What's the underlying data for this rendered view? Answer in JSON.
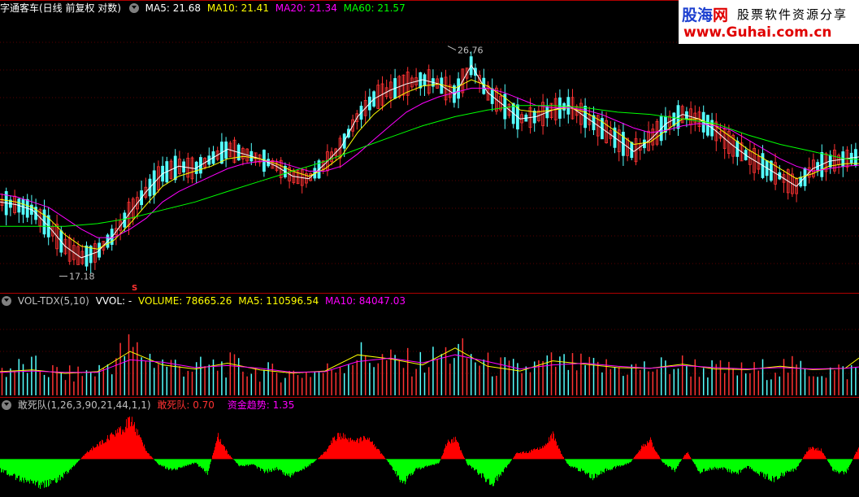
{
  "main": {
    "title": "字通客车(日线 前复权 对数)",
    "ma5_label": "MA5: 21.68",
    "ma10_label": "MA10: 21.41",
    "ma20_label": "MA20: 21.34",
    "ma60_label": "MA60: 21.57",
    "high_label": "26.76",
    "low_label": "17.18",
    "signal_label": "S"
  },
  "vol": {
    "title": "VOL-TDX(5,10)",
    "vvol_label": "VVOL: -",
    "volume_label": "VOLUME: 78665.26",
    "ma5_label": "MA5: 110596.54",
    "ma10_label": "MA10: 84047.03"
  },
  "ind": {
    "title": "敢死队(1,26,3,90,21,44,1,1)",
    "gsd_label": "敢死队: 0.70",
    "zjqs_label": "资金趋势: 1.35"
  },
  "watermark": {
    "line1_blue": "股海",
    "line1_red": "网",
    "line1_right": "股票软件资源分享",
    "line2": "www.Guhai.com.cn"
  },
  "colors": {
    "up": "#ff3232",
    "down": "#54ffff",
    "ma5": "#ffffff",
    "ma10": "#ffff00",
    "ma20": "#ff00ff",
    "ma60": "#00ff00",
    "separator": "#b00000",
    "positive_fill": "#ff0000",
    "negative_fill": "#00ff00"
  },
  "chart_data": [
    {
      "type": "candlestick",
      "title": "字通客车(日线 前复权 对数)",
      "series": [
        {
          "name": "MA5",
          "x": [
            0,
            20,
            40,
            60,
            80,
            100,
            120,
            140,
            160,
            180,
            200,
            220,
            240,
            260,
            280,
            300,
            320,
            340,
            360,
            380,
            400,
            420,
            440,
            460,
            480,
            500,
            520,
            540,
            560,
            580,
            600,
            620,
            640,
            660,
            680,
            700,
            720,
            740,
            760,
            780,
            800,
            820,
            840,
            860,
            880,
            900,
            920,
            940,
            960,
            980,
            1000,
            1020,
            1040,
            1057
          ],
          "values": [
            19.9,
            19.8,
            19.6,
            19.0,
            18.3,
            17.9,
            18.1,
            18.7,
            19.5,
            20.3,
            21.0,
            21.3,
            21.2,
            21.6,
            22.0,
            21.8,
            21.6,
            21.3,
            20.9,
            20.8,
            21.4,
            22.1,
            23.4,
            24.2,
            24.6,
            24.9,
            25.1,
            24.9,
            24.4,
            25.8,
            24.5,
            23.9,
            23.3,
            23.4,
            23.7,
            23.9,
            23.4,
            22.9,
            22.4,
            21.9,
            22.4,
            23.1,
            23.5,
            23.3,
            22.8,
            22.2,
            21.7,
            21.3,
            20.9,
            20.5,
            21.2,
            21.5,
            21.6,
            21.68
          ]
        },
        {
          "name": "MA10",
          "x": [
            0,
            20,
            40,
            60,
            80,
            100,
            120,
            140,
            160,
            180,
            200,
            220,
            240,
            260,
            280,
            300,
            320,
            340,
            360,
            380,
            400,
            420,
            440,
            460,
            480,
            500,
            520,
            540,
            560,
            580,
            600,
            620,
            640,
            660,
            680,
            700,
            720,
            740,
            760,
            780,
            800,
            820,
            840,
            860,
            880,
            900,
            920,
            940,
            960,
            980,
            1000,
            1020,
            1040,
            1057
          ],
          "values": [
            20.0,
            19.9,
            19.7,
            19.3,
            18.7,
            18.3,
            18.2,
            18.5,
            19.1,
            19.8,
            20.5,
            20.9,
            21.1,
            21.3,
            21.6,
            21.7,
            21.6,
            21.4,
            21.1,
            20.9,
            21.2,
            21.7,
            22.7,
            23.5,
            24.1,
            24.5,
            24.8,
            24.9,
            24.7,
            25.1,
            24.8,
            24.3,
            23.7,
            23.6,
            23.7,
            23.8,
            23.6,
            23.2,
            22.7,
            22.2,
            22.3,
            22.8,
            23.3,
            23.3,
            23.0,
            22.5,
            22.0,
            21.6,
            21.2,
            20.8,
            21.0,
            21.3,
            21.4,
            21.41
          ]
        },
        {
          "name": "MA20",
          "x": [
            0,
            20,
            40,
            60,
            80,
            100,
            120,
            140,
            160,
            180,
            200,
            220,
            240,
            260,
            280,
            300,
            320,
            340,
            360,
            380,
            400,
            420,
            440,
            460,
            480,
            500,
            520,
            540,
            560,
            580,
            600,
            620,
            640,
            660,
            680,
            700,
            720,
            740,
            760,
            780,
            800,
            820,
            840,
            860,
            880,
            900,
            920,
            940,
            960,
            980,
            1000,
            1020,
            1040,
            1057
          ],
          "values": [
            20.2,
            20.1,
            19.9,
            19.7,
            19.3,
            18.9,
            18.6,
            18.6,
            18.9,
            19.3,
            19.9,
            20.3,
            20.6,
            20.9,
            21.2,
            21.4,
            21.5,
            21.5,
            21.3,
            21.1,
            21.1,
            21.3,
            21.8,
            22.4,
            23.0,
            23.6,
            24.0,
            24.3,
            24.5,
            24.7,
            24.7,
            24.5,
            24.2,
            23.9,
            23.8,
            23.8,
            23.7,
            23.5,
            23.2,
            22.9,
            22.7,
            22.8,
            23.0,
            23.1,
            23.0,
            22.8,
            22.4,
            22.0,
            21.6,
            21.3,
            21.1,
            21.2,
            21.3,
            21.34
          ]
        },
        {
          "name": "MA60",
          "x": [
            0,
            40,
            80,
            120,
            160,
            200,
            240,
            280,
            320,
            360,
            400,
            440,
            480,
            520,
            560,
            600,
            640,
            680,
            720,
            760,
            800,
            840,
            880,
            920,
            960,
            1000,
            1040,
            1057
          ],
          "values": [
            19.0,
            19.0,
            19.0,
            19.1,
            19.3,
            19.6,
            19.9,
            20.3,
            20.7,
            21.1,
            21.5,
            22.0,
            22.5,
            23.0,
            23.4,
            23.7,
            23.9,
            23.9,
            23.8,
            23.6,
            23.5,
            23.3,
            23.1,
            22.6,
            22.2,
            21.9,
            21.6,
            21.57
          ]
        }
      ],
      "annotations": [
        {
          "text": "26.76"
        },
        {
          "text": "17.18"
        }
      ],
      "ylim": [
        16.8,
        28.4
      ],
      "scale": "log"
    },
    {
      "type": "bar",
      "title": "VOL-TDX(5,10)",
      "series": [
        {
          "name": "VOLUME",
          "x": [
            0,
            40,
            80,
            120,
            160,
            200,
            240,
            280,
            320,
            360,
            400,
            440,
            480,
            520,
            560,
            600,
            640,
            680,
            720,
            760,
            800,
            840,
            880,
            920,
            960,
            1000,
            1040,
            1057
          ],
          "values": [
            75000,
            85000,
            60000,
            70000,
            140000,
            95000,
            80000,
            90000,
            70000,
            65000,
            70000,
            120000,
            100000,
            95000,
            130000,
            90000,
            75000,
            95000,
            85000,
            80000,
            80000,
            90000,
            75000,
            70000,
            85000,
            75000,
            70000,
            78665
          ]
        },
        {
          "name": "MA5",
          "x": [
            0,
            40,
            80,
            120,
            160,
            200,
            240,
            280,
            320,
            360,
            400,
            440,
            480,
            520,
            560,
            600,
            640,
            680,
            720,
            760,
            800,
            840,
            880,
            920,
            960,
            1000,
            1040,
            1057
          ],
          "values": [
            70000,
            75000,
            65000,
            70000,
            130000,
            90000,
            78000,
            95000,
            75000,
            66000,
            72000,
            120000,
            108000,
            90000,
            140000,
            86000,
            72000,
            102000,
            92000,
            82000,
            80000,
            92000,
            78000,
            76000,
            86000,
            76000,
            80000,
            110597
          ]
        },
        {
          "name": "MA10",
          "x": [
            0,
            40,
            80,
            120,
            160,
            200,
            240,
            280,
            320,
            360,
            400,
            440,
            480,
            520,
            560,
            600,
            640,
            680,
            720,
            760,
            800,
            840,
            880,
            920,
            960,
            1000,
            1040,
            1057
          ],
          "values": [
            68000,
            72000,
            68000,
            68000,
            105000,
            98000,
            82000,
            88000,
            80000,
            68000,
            70000,
            100000,
            110000,
            96000,
            120000,
            100000,
            78000,
            90000,
            95000,
            86000,
            80000,
            88000,
            82000,
            78000,
            82000,
            78000,
            80000,
            84047
          ]
        }
      ],
      "ylim": [
        0,
        260000
      ]
    },
    {
      "type": "area",
      "title": "敢死队(1,26,3,90,21,44,1,1)",
      "series": [
        {
          "name": "敢死队",
          "x": [
            0,
            15,
            30,
            45,
            60,
            75,
            90,
            105,
            120,
            135,
            150,
            160,
            170,
            180,
            195,
            210,
            225,
            240,
            255,
            268,
            280,
            295,
            310,
            325,
            340,
            355,
            370,
            385,
            400,
            410,
            420,
            435,
            450,
            465,
            480,
            495,
            510,
            525,
            540,
            550,
            560,
            575,
            590,
            605,
            620,
            635,
            650,
            665,
            680,
            690,
            700,
            715,
            730,
            745,
            760,
            775,
            790,
            800,
            815,
            830,
            845,
            860,
            875,
            890,
            905,
            920,
            935,
            950,
            965,
            980,
            995,
            1010,
            1025,
            1040,
            1057
          ],
          "values": [
            -0.6,
            -0.9,
            -1.2,
            -1.4,
            -1.3,
            -1.0,
            -0.4,
            0.3,
            0.8,
            1.2,
            1.6,
            2.1,
            1.3,
            0.4,
            -0.3,
            -0.6,
            -0.4,
            -0.2,
            -0.8,
            1.3,
            0.3,
            -0.4,
            -0.3,
            -0.7,
            -0.5,
            -0.9,
            -0.6,
            -0.2,
            0.4,
            1.1,
            1.3,
            0.9,
            1.2,
            0.5,
            -0.3,
            -1.3,
            -0.6,
            -0.4,
            -0.2,
            0.9,
            1.1,
            -0.3,
            -0.8,
            -1.4,
            -0.6,
            0.3,
            0.4,
            0.6,
            1.3,
            0.3,
            -0.4,
            -0.6,
            -1.0,
            -0.6,
            -0.4,
            -0.2,
            0.7,
            1.0,
            -0.2,
            -0.6,
            0.4,
            -0.7,
            -0.5,
            -0.5,
            -0.8,
            -0.4,
            -0.8,
            -1.1,
            -0.8,
            -0.5,
            0.6,
            0.5,
            -0.6,
            -0.8,
            0.7
          ]
        }
      ],
      "ylim": [
        -2.0,
        2.5
      ]
    }
  ]
}
